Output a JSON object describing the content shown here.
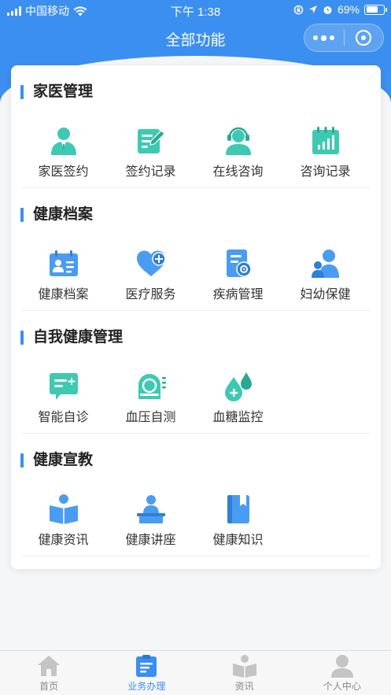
{
  "status_bar": {
    "carrier": "中国移动",
    "time": "下午 1:38",
    "battery": "69%",
    "battery_level": 0.69
  },
  "nav": {
    "title": "全部功能",
    "more_icon": "more-dots-icon",
    "close_icon": "target-circle-icon"
  },
  "colors": {
    "primary": "#3b8ff0",
    "teal": "#3ec9b3",
    "icon_blue": "#4a9cf3"
  },
  "sections": [
    {
      "title": "家医管理",
      "items": [
        {
          "label": "家医签约",
          "icon": "doctor-person-icon"
        },
        {
          "label": "签约记录",
          "icon": "edit-document-icon"
        },
        {
          "label": "在线咨询",
          "icon": "headset-agent-icon"
        },
        {
          "label": "咨询记录",
          "icon": "calendar-chart-icon"
        }
      ]
    },
    {
      "title": "健康档案",
      "items": [
        {
          "label": "健康档案",
          "icon": "id-card-icon"
        },
        {
          "label": "医疗服务",
          "icon": "heart-plus-icon"
        },
        {
          "label": "疾病管理",
          "icon": "document-gear-icon"
        },
        {
          "label": "妇幼保健",
          "icon": "mother-child-icon"
        }
      ]
    },
    {
      "title": "自我健康管理",
      "items": [
        {
          "label": "智能自诊",
          "icon": "chat-plus-icon"
        },
        {
          "label": "血压自测",
          "icon": "blood-pressure-icon"
        },
        {
          "label": "血糖监控",
          "icon": "blood-drop-icon"
        }
      ]
    },
    {
      "title": "健康宣教",
      "items": [
        {
          "label": "健康资讯",
          "icon": "person-reading-icon"
        },
        {
          "label": "健康讲座",
          "icon": "lecturer-podium-icon"
        },
        {
          "label": "健康知识",
          "icon": "bookmark-book-icon"
        }
      ]
    }
  ],
  "tabbar": [
    {
      "label": "首页",
      "icon": "home-icon",
      "active": false
    },
    {
      "label": "业务办理",
      "icon": "clipboard-icon",
      "active": true
    },
    {
      "label": "资讯",
      "icon": "open-book-person-icon",
      "active": false
    },
    {
      "label": "个人中心",
      "icon": "user-icon",
      "active": false
    }
  ]
}
